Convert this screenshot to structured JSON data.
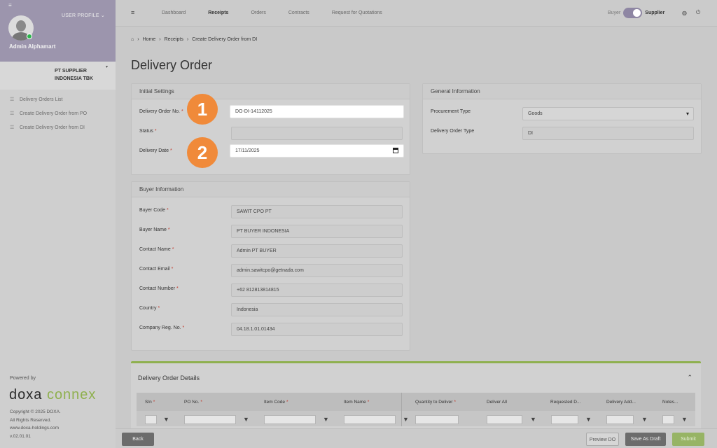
{
  "sidebar": {
    "menu_icon": "≡",
    "user_profile_label": "USER PROFILE",
    "admin_name": "Admin Alphamart",
    "company_name": "PT SUPPLIER INDONESIA TBK",
    "nav_items": [
      {
        "label": "Delivery Orders List",
        "icon": "list-icon"
      },
      {
        "label": "Create Delivery Order from PO",
        "icon": "list-icon"
      },
      {
        "label": "Create Delivery Order from DI",
        "icon": "list-icon"
      }
    ],
    "powered_by": "Powered by",
    "logo_left": "doxa",
    "logo_right": "connex",
    "copyright": "Copyright © 2025 DOXA.",
    "rights": "All Rights Reserved.",
    "website": "www.doxa-holdings.com",
    "version": "v.02.01.01"
  },
  "topbar": {
    "nav": [
      "Dashboard",
      "Receipts",
      "Orders",
      "Contracts",
      "Request for Quotations"
    ],
    "active_nav": "Receipts",
    "buyer_label": "Buyer",
    "supplier_label": "Supplier"
  },
  "breadcrumb": [
    "Home",
    "Receipts",
    "Create Delivery Order from DI"
  ],
  "page_title": "Delivery Order",
  "initial_settings": {
    "title": "Initial Settings",
    "do_no_label": "Delivery Order No.",
    "do_no_value": "DO-DI-14112025",
    "status_label": "Status",
    "status_value": "",
    "date_label": "Delivery Date",
    "date_value": "17/11/2025"
  },
  "general_info": {
    "title": "General Information",
    "procurement_label": "Procurement Type",
    "procurement_value": "Goods",
    "do_type_label": "Delivery Order Type",
    "do_type_value": "DI"
  },
  "buyer_info": {
    "title": "Buyer Information",
    "fields": [
      {
        "label": "Buyer Code",
        "value": "SAWIT CPO PT"
      },
      {
        "label": "Buyer Name",
        "value": "PT BUYER INDONESIA"
      },
      {
        "label": "Contact Name",
        "value": "Admin PT BUYER"
      },
      {
        "label": "Contact Email",
        "value": "admin.sawitcpo@getnada.com"
      },
      {
        "label": "Contact Number",
        "value": "+62 812813814815"
      },
      {
        "label": "Country",
        "value": "Indonesia"
      },
      {
        "label": "Company Reg. No.",
        "value": "04.18.1.01.01434"
      }
    ]
  },
  "badges": [
    "1",
    "2"
  ],
  "details": {
    "title": "Delivery Order Details",
    "columns": [
      "S/n",
      "PO No.",
      "Item Code",
      "Item Name",
      "Quantity to Deliver",
      "Deliver All",
      "Requested D...",
      "Delivery Add...",
      "Notes..."
    ],
    "required": [
      true,
      true,
      true,
      true,
      true,
      false,
      false,
      false,
      false
    ]
  },
  "actions": {
    "back": "Back",
    "preview": "Preview DO",
    "draft": "Save As Draft",
    "submit": "Submit"
  },
  "colors": {
    "accent_green": "#8fb04f",
    "profile_purple": "#9c95ad",
    "badge_orange": "#f08a3a"
  }
}
